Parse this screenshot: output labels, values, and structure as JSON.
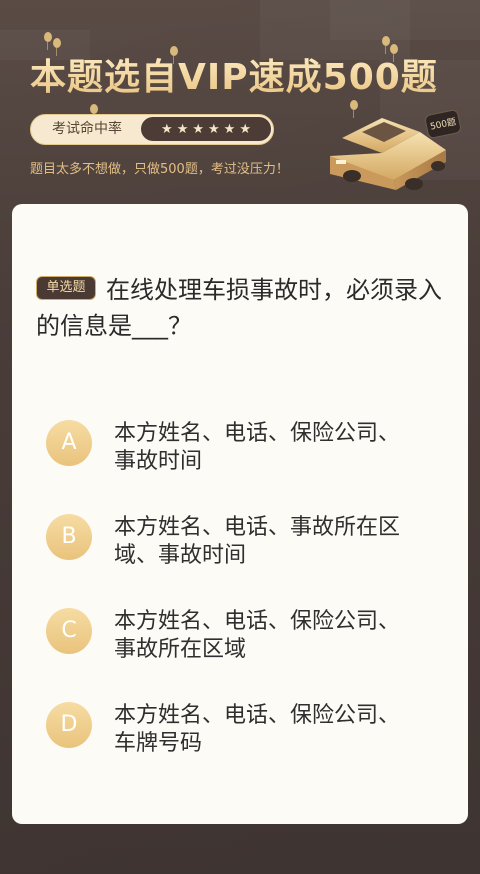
{
  "header": {
    "title": "本题选自VIP速成500题",
    "rate_label": "考试命中率",
    "stars": [
      "★",
      "★",
      "★",
      "★",
      "★",
      "★"
    ],
    "subtitle": "题目太多不想做，只做500题，考过没压力！",
    "badge": "500题",
    "car_icon": "car-icon"
  },
  "question": {
    "tag": "单选题",
    "text": "在线处理车损事故时，必须录入的信息是___？"
  },
  "options": [
    {
      "letter": "A",
      "text": "本方姓名、电话、保险公司、事故时间"
    },
    {
      "letter": "B",
      "text": "本方姓名、电话、事故所在区域、事故时间"
    },
    {
      "letter": "C",
      "text": "本方姓名、电话、保险公司、事故所在区域"
    },
    {
      "letter": "D",
      "text": "本方姓名、电话、保险公司、车牌号码"
    }
  ],
  "colors": {
    "background": "#4b3f3b",
    "gold": "#e8c27f",
    "card": "#fdfbf6"
  }
}
